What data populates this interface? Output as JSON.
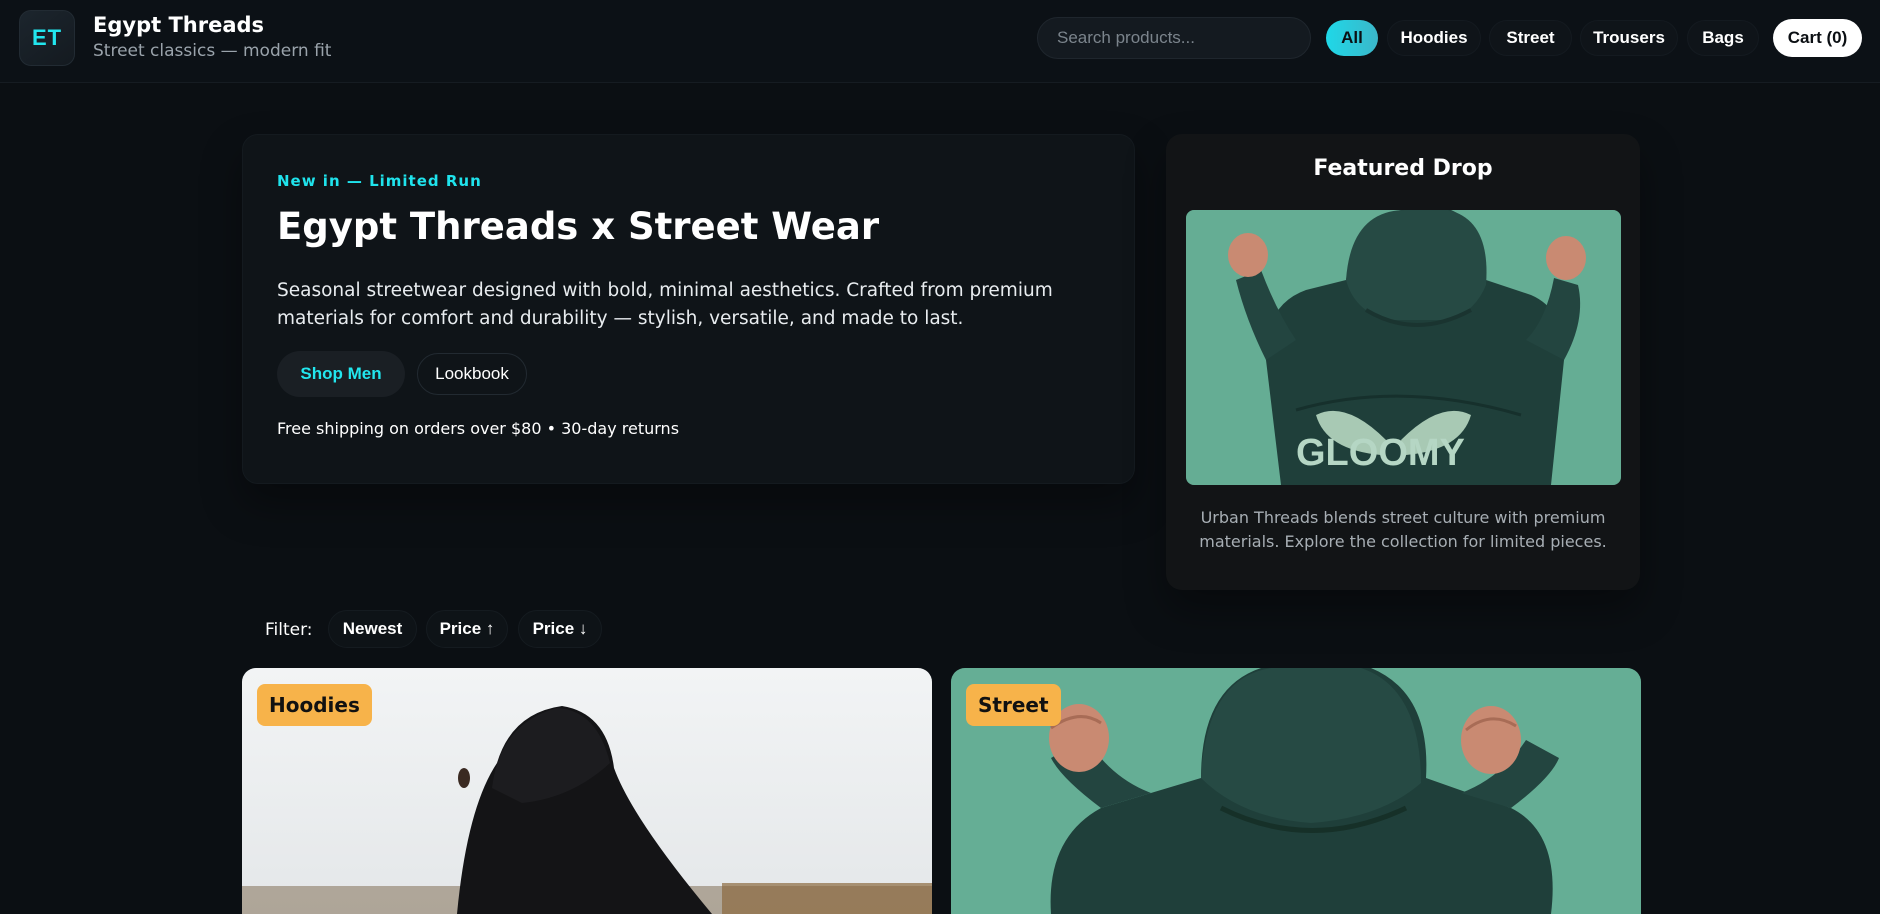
{
  "header": {
    "logo_text": "ET",
    "brand_title": "Egypt Threads",
    "brand_subtitle": "Street classics — modern fit",
    "search_placeholder": "Search products...",
    "categories": [
      "All",
      "Hoodies",
      "Street",
      "Trousers",
      "Bags"
    ],
    "active_category": "All",
    "cart_label": "Cart (0)"
  },
  "hero": {
    "eyebrow": "New in — Limited Run",
    "title": "Egypt Threads x Street Wear",
    "description": "Seasonal streetwear designed with bold, minimal aesthetics. Crafted from premium materials for comfort and durability — stylish, versatile, and made to last.",
    "primary_button": "Shop Men",
    "secondary_button": "Lookbook",
    "note": "Free shipping on orders over $80 • 30-day returns"
  },
  "featured": {
    "title": "Featured Drop",
    "image_print_text": "GLOOMY",
    "description": "Urban Threads blends street culture with premium materials. Explore the collection for limited pieces."
  },
  "filter": {
    "label": "Filter:",
    "options": [
      "Newest",
      "Price ↑",
      "Price ↓"
    ]
  },
  "products": [
    {
      "tag": "Hoodies"
    },
    {
      "tag": "Street"
    }
  ],
  "colors": {
    "background": "#0b0f13",
    "accent_cyan": "#1fe3ec",
    "tag_orange": "#f7b34a",
    "featured_teal": "#5fa98f"
  }
}
